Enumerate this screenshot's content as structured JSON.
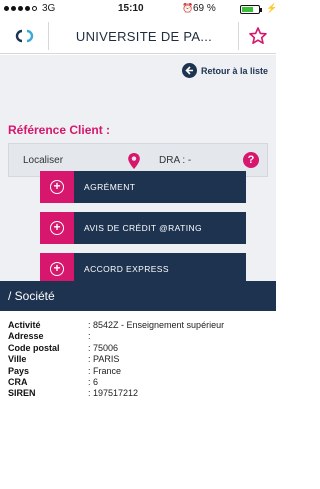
{
  "status_bar": {
    "carrier": "3G",
    "time": "15:10",
    "battery_pct": "69 %",
    "battery_level": 0.69
  },
  "header": {
    "title": "UNIVERSITE DE PA..."
  },
  "back_link": {
    "label": "Retour à la liste"
  },
  "reference": {
    "title": "Référence Client :",
    "locate_label": "Localiser",
    "dra_label": "DRA : -"
  },
  "actions": [
    {
      "label": "AGRÉMENT"
    },
    {
      "label": "AVIS DE CRÉDIT @RATING"
    },
    {
      "label": "ACCORD EXPRESS"
    }
  ],
  "section": {
    "title": "/ Société"
  },
  "company": [
    {
      "key": "Activité",
      "value": ": 8542Z - Enseignement supérieur"
    },
    {
      "key": "Adresse",
      "value": ":"
    },
    {
      "key": "Code postal",
      "value": ": 75006"
    },
    {
      "key": "Ville",
      "value": ": PARIS"
    },
    {
      "key": "Pays",
      "value": ": France"
    },
    {
      "key": "CRA",
      "value": ": 6"
    },
    {
      "key": "SIREN",
      "value": ": 197517212"
    }
  ],
  "colors": {
    "navy": "#1d3350",
    "magenta": "#d6176d",
    "background": "#eef0f3"
  },
  "icons": {
    "back": "arrow-left-circle-icon",
    "locate": "map-pin-icon",
    "help": "question-circle-icon",
    "favorite": "star-outline-icon",
    "logo": "cd-logo-icon"
  }
}
